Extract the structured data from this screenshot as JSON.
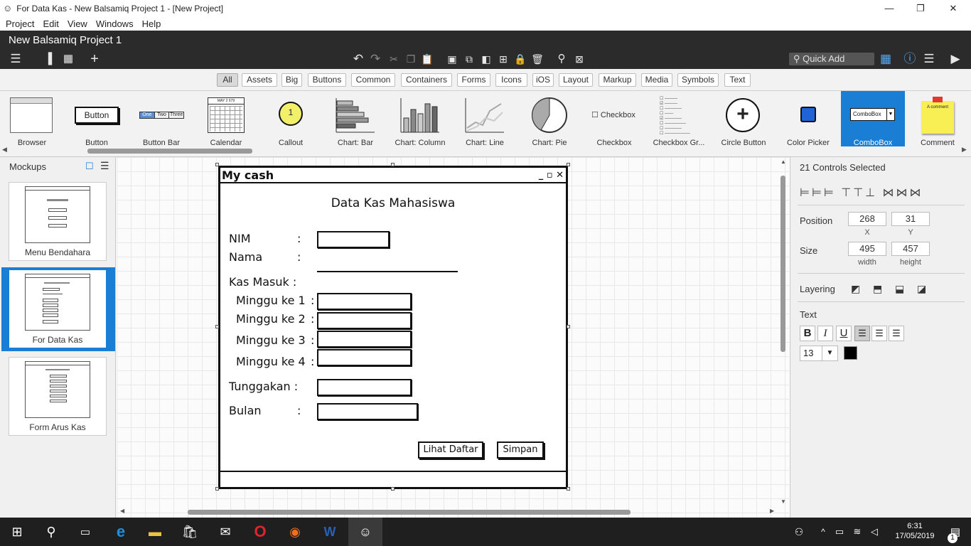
{
  "window": {
    "title": "For Data Kas - New Balsamiq Project 1 - [New Project]",
    "minimize": "—",
    "restore": "❐",
    "close": "✕"
  },
  "menu": [
    "Project",
    "Edit",
    "View",
    "Windows",
    "Help"
  ],
  "project_name": "New Balsamiq Project 1",
  "quick_add": "Quick Add",
  "filters": [
    {
      "label": "All",
      "selected": true
    },
    {
      "label": "Assets"
    },
    {
      "label": "Big"
    },
    {
      "label": "Buttons"
    },
    {
      "label": "Common"
    },
    {
      "label": "Containers"
    },
    {
      "label": "Forms"
    },
    {
      "label": "Icons"
    },
    {
      "label": "iOS"
    },
    {
      "label": "Layout"
    },
    {
      "label": "Markup"
    },
    {
      "label": "Media"
    },
    {
      "label": "Symbols"
    },
    {
      "label": "Text"
    }
  ],
  "library": [
    {
      "label": "Browser",
      "icon": "browser-icon"
    },
    {
      "label": "Button",
      "icon": "button-icon",
      "sample": "Button"
    },
    {
      "label": "Button Bar",
      "icon": "button-bar-icon",
      "parts": [
        "One",
        "Two",
        "Three"
      ]
    },
    {
      "label": "Calendar",
      "icon": "calendar-icon",
      "header": "MAY 2 079"
    },
    {
      "label": "Callout",
      "icon": "callout-icon",
      "sample": "1"
    },
    {
      "label": "Chart: Bar",
      "icon": "chart-bar-icon"
    },
    {
      "label": "Chart: Column",
      "icon": "chart-column-icon"
    },
    {
      "label": "Chart: Line",
      "icon": "chart-line-icon"
    },
    {
      "label": "Chart: Pie",
      "icon": "chart-pie-icon"
    },
    {
      "label": "Checkbox",
      "icon": "checkbox-icon",
      "sample": "Checkbox"
    },
    {
      "label": "Checkbox Gr...",
      "icon": "checkbox-group-icon"
    },
    {
      "label": "Circle Button",
      "icon": "circle-button-icon",
      "sample": "+"
    },
    {
      "label": "Color Picker",
      "icon": "color-picker-icon"
    },
    {
      "label": "ComboBox",
      "icon": "combobox-icon",
      "sample": "ComboBox",
      "selected": true
    },
    {
      "label": "Comment",
      "icon": "comment-icon",
      "sample": "A comment"
    }
  ],
  "mockups_panel": {
    "title": "Mockups",
    "items": [
      {
        "label": "Menu Bendahara",
        "selected": false
      },
      {
        "label": "For Data Kas",
        "selected": true
      },
      {
        "label": "Form Arus Kas",
        "selected": false
      }
    ]
  },
  "mockup": {
    "window_title": "My cash",
    "window_controls": "_ ▫ ✕",
    "heading": "Data Kas Mahasiswa",
    "nim_label": "NIM",
    "nama_label": "Nama",
    "colon": ":",
    "kas_masuk_label": "Kas Masuk :",
    "weeks": [
      "Minggu ke 1",
      "Minggu ke 2",
      "Minggu ke 3",
      "Minggu ke 4"
    ],
    "tunggakan_label": "Tunggakan :",
    "bulan_label": "Bulan",
    "lihat_button": "Lihat Daftar",
    "simpan_button": "Simpan"
  },
  "properties": {
    "header": "21 Controls Selected",
    "position_label": "Position",
    "x_value": "268",
    "x_caption": "X",
    "y_value": "31",
    "y_caption": "Y",
    "size_label": "Size",
    "width_value": "495",
    "width_caption": "width",
    "height_value": "457",
    "height_caption": "height",
    "layering_label": "Layering",
    "text_label": "Text",
    "bold": "B",
    "italic": "I",
    "underline": "U",
    "font_size": "13",
    "text_color": "#000000"
  },
  "taskbar": {
    "time": "6:31",
    "date": "17/05/2019",
    "notification_count": "1"
  },
  "colors": {
    "accent": "#1a7ed4",
    "dark_bar": "#2b2b2b",
    "taskbar": "#1f1f1f"
  }
}
